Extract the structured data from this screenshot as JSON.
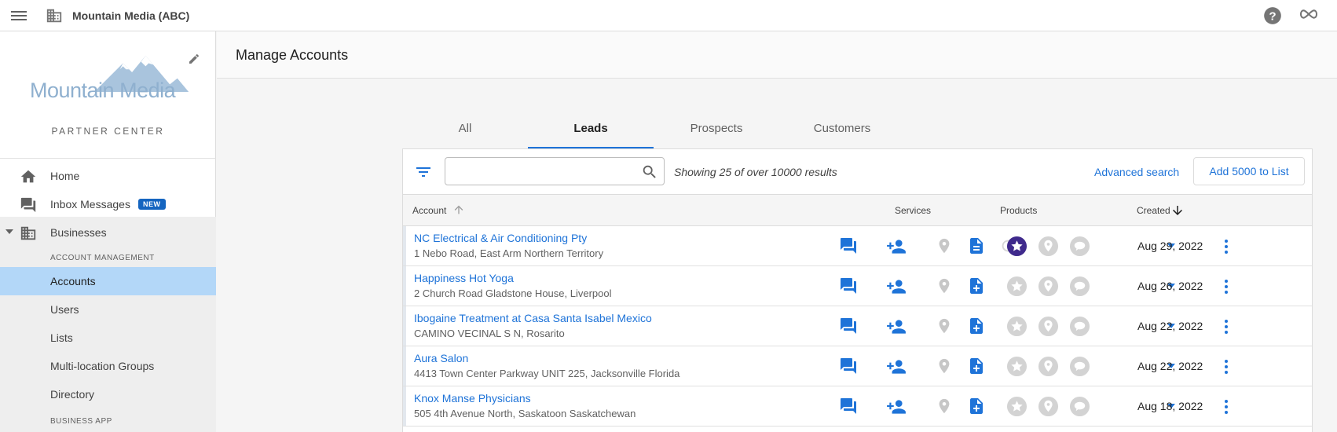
{
  "topbar": {
    "brand": "Mountain Media (ABC)"
  },
  "sidebar": {
    "logo_text": "Mountain Media",
    "partner_center": "PARTNER CENTER",
    "home": "Home",
    "inbox": "Inbox Messages",
    "inbox_badge": "NEW",
    "businesses": "Businesses",
    "section_account_management": "ACCOUNT MANAGEMENT",
    "accounts": "Accounts",
    "users": "Users",
    "lists": "Lists",
    "multi_location": "Multi-location Groups",
    "directory": "Directory",
    "section_business_app": "BUSINESS APP"
  },
  "main": {
    "title": "Manage Accounts",
    "tabs": [
      "All",
      "Leads",
      "Prospects",
      "Customers"
    ],
    "active_tab": "Leads",
    "search_placeholder": "",
    "results_text": "Showing 25 of over 10000 results",
    "advanced_search": "Advanced search",
    "add_button": "Add 5000 to List",
    "columns": {
      "account": "Account",
      "services": "Services",
      "products": "Products",
      "created": "Created"
    },
    "rows": [
      {
        "name": "NC Electrical & Air Conditioning Pty",
        "address": "1 Nebo Road, East Arm Northern Territory",
        "created": "Aug 29, 2022",
        "service_doc": "document",
        "has_refresh": true,
        "product_star_active": true
      },
      {
        "name": "Happiness Hot Yoga",
        "address": "2 Church Road Gladstone House, Liverpool",
        "created": "Aug 26, 2022",
        "service_doc": "document-add",
        "has_refresh": false,
        "product_star_active": false
      },
      {
        "name": "Ibogaine Treatment at Casa Santa Isabel Mexico",
        "address": "CAMINO VECINAL S N, Rosarito",
        "created": "Aug 22, 2022",
        "service_doc": "document-add",
        "has_refresh": false,
        "product_star_active": false
      },
      {
        "name": "Aura Salon",
        "address": "4413 Town Center Parkway UNIT 225, Jacksonville Florida",
        "created": "Aug 22, 2022",
        "service_doc": "document-add",
        "has_refresh": false,
        "product_star_active": false
      },
      {
        "name": "Knox Manse Physicians",
        "address": "505 4th Avenue North, Saskatoon Saskatchewan",
        "created": "Aug 18, 2022",
        "service_doc": "document-add",
        "has_refresh": false,
        "product_star_active": false
      }
    ]
  },
  "colors": {
    "accent": "#1e73d8",
    "active_nav": "#b3d7f8",
    "star_active": "#3f2a8c",
    "icon_grey": "#c7c7c7"
  }
}
